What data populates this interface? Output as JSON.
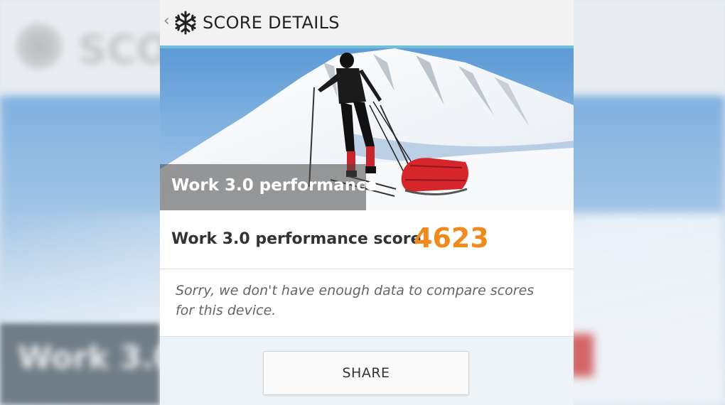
{
  "header": {
    "title": "SCORE DETAILS",
    "back_icon": "back-chevron-icon",
    "logo_icon": "snowflake-logo-icon"
  },
  "hero": {
    "title": "Work 3.0 performance",
    "version": "3.0",
    "image": "skier-pulling-red-sled-in-snow"
  },
  "score": {
    "label": "Work 3.0 performance score",
    "value": "4623",
    "color": "#f08a1c"
  },
  "note": {
    "text": "Sorry, we don't have enough data to compare scores for this device."
  },
  "actions": {
    "share_label": "SHARE"
  },
  "colors": {
    "accent_line": "#6fbfd8",
    "score": "#f08a1c"
  }
}
